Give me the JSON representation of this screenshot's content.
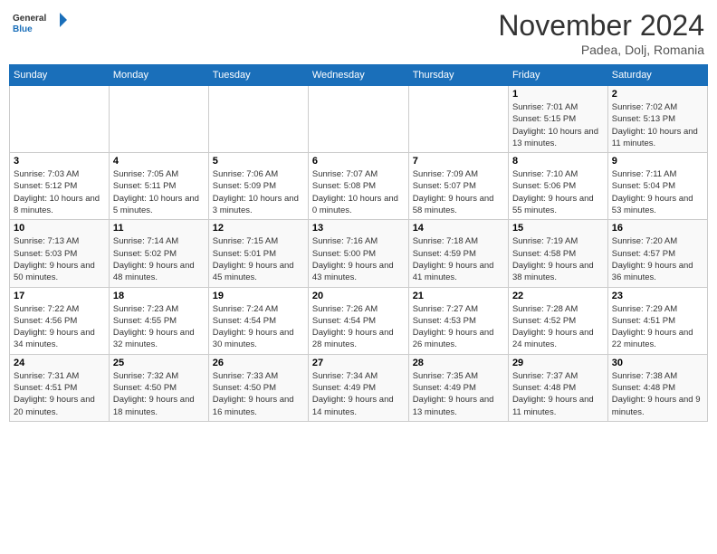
{
  "header": {
    "logo_line1": "General",
    "logo_line2": "Blue",
    "month": "November 2024",
    "location": "Padea, Dolj, Romania"
  },
  "weekdays": [
    "Sunday",
    "Monday",
    "Tuesday",
    "Wednesday",
    "Thursday",
    "Friday",
    "Saturday"
  ],
  "weeks": [
    [
      {
        "day": "",
        "info": ""
      },
      {
        "day": "",
        "info": ""
      },
      {
        "day": "",
        "info": ""
      },
      {
        "day": "",
        "info": ""
      },
      {
        "day": "",
        "info": ""
      },
      {
        "day": "1",
        "info": "Sunrise: 7:01 AM\nSunset: 5:15 PM\nDaylight: 10 hours and 13 minutes."
      },
      {
        "day": "2",
        "info": "Sunrise: 7:02 AM\nSunset: 5:13 PM\nDaylight: 10 hours and 11 minutes."
      }
    ],
    [
      {
        "day": "3",
        "info": "Sunrise: 7:03 AM\nSunset: 5:12 PM\nDaylight: 10 hours and 8 minutes."
      },
      {
        "day": "4",
        "info": "Sunrise: 7:05 AM\nSunset: 5:11 PM\nDaylight: 10 hours and 5 minutes."
      },
      {
        "day": "5",
        "info": "Sunrise: 7:06 AM\nSunset: 5:09 PM\nDaylight: 10 hours and 3 minutes."
      },
      {
        "day": "6",
        "info": "Sunrise: 7:07 AM\nSunset: 5:08 PM\nDaylight: 10 hours and 0 minutes."
      },
      {
        "day": "7",
        "info": "Sunrise: 7:09 AM\nSunset: 5:07 PM\nDaylight: 9 hours and 58 minutes."
      },
      {
        "day": "8",
        "info": "Sunrise: 7:10 AM\nSunset: 5:06 PM\nDaylight: 9 hours and 55 minutes."
      },
      {
        "day": "9",
        "info": "Sunrise: 7:11 AM\nSunset: 5:04 PM\nDaylight: 9 hours and 53 minutes."
      }
    ],
    [
      {
        "day": "10",
        "info": "Sunrise: 7:13 AM\nSunset: 5:03 PM\nDaylight: 9 hours and 50 minutes."
      },
      {
        "day": "11",
        "info": "Sunrise: 7:14 AM\nSunset: 5:02 PM\nDaylight: 9 hours and 48 minutes."
      },
      {
        "day": "12",
        "info": "Sunrise: 7:15 AM\nSunset: 5:01 PM\nDaylight: 9 hours and 45 minutes."
      },
      {
        "day": "13",
        "info": "Sunrise: 7:16 AM\nSunset: 5:00 PM\nDaylight: 9 hours and 43 minutes."
      },
      {
        "day": "14",
        "info": "Sunrise: 7:18 AM\nSunset: 4:59 PM\nDaylight: 9 hours and 41 minutes."
      },
      {
        "day": "15",
        "info": "Sunrise: 7:19 AM\nSunset: 4:58 PM\nDaylight: 9 hours and 38 minutes."
      },
      {
        "day": "16",
        "info": "Sunrise: 7:20 AM\nSunset: 4:57 PM\nDaylight: 9 hours and 36 minutes."
      }
    ],
    [
      {
        "day": "17",
        "info": "Sunrise: 7:22 AM\nSunset: 4:56 PM\nDaylight: 9 hours and 34 minutes."
      },
      {
        "day": "18",
        "info": "Sunrise: 7:23 AM\nSunset: 4:55 PM\nDaylight: 9 hours and 32 minutes."
      },
      {
        "day": "19",
        "info": "Sunrise: 7:24 AM\nSunset: 4:54 PM\nDaylight: 9 hours and 30 minutes."
      },
      {
        "day": "20",
        "info": "Sunrise: 7:26 AM\nSunset: 4:54 PM\nDaylight: 9 hours and 28 minutes."
      },
      {
        "day": "21",
        "info": "Sunrise: 7:27 AM\nSunset: 4:53 PM\nDaylight: 9 hours and 26 minutes."
      },
      {
        "day": "22",
        "info": "Sunrise: 7:28 AM\nSunset: 4:52 PM\nDaylight: 9 hours and 24 minutes."
      },
      {
        "day": "23",
        "info": "Sunrise: 7:29 AM\nSunset: 4:51 PM\nDaylight: 9 hours and 22 minutes."
      }
    ],
    [
      {
        "day": "24",
        "info": "Sunrise: 7:31 AM\nSunset: 4:51 PM\nDaylight: 9 hours and 20 minutes."
      },
      {
        "day": "25",
        "info": "Sunrise: 7:32 AM\nSunset: 4:50 PM\nDaylight: 9 hours and 18 minutes."
      },
      {
        "day": "26",
        "info": "Sunrise: 7:33 AM\nSunset: 4:50 PM\nDaylight: 9 hours and 16 minutes."
      },
      {
        "day": "27",
        "info": "Sunrise: 7:34 AM\nSunset: 4:49 PM\nDaylight: 9 hours and 14 minutes."
      },
      {
        "day": "28",
        "info": "Sunrise: 7:35 AM\nSunset: 4:49 PM\nDaylight: 9 hours and 13 minutes."
      },
      {
        "day": "29",
        "info": "Sunrise: 7:37 AM\nSunset: 4:48 PM\nDaylight: 9 hours and 11 minutes."
      },
      {
        "day": "30",
        "info": "Sunrise: 7:38 AM\nSunset: 4:48 PM\nDaylight: 9 hours and 9 minutes."
      }
    ]
  ]
}
